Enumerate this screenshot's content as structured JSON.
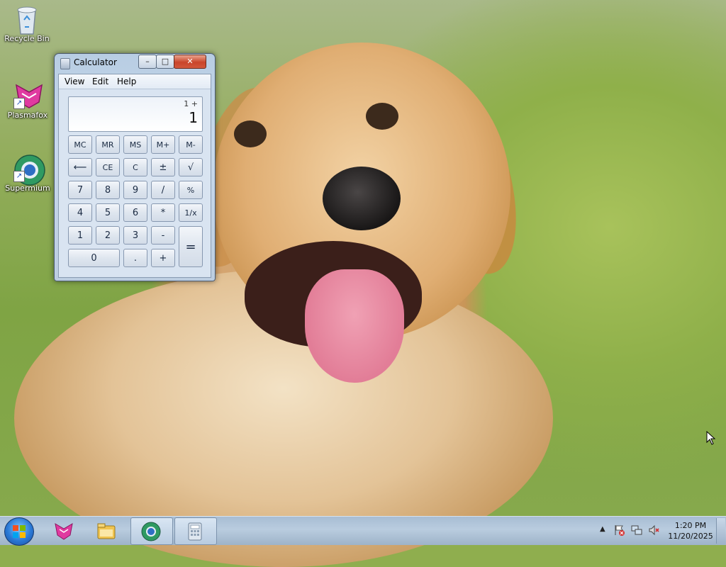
{
  "desktop": {
    "icons": [
      {
        "label": "Recycle Bin",
        "icon": "recycle-bin-icon"
      },
      {
        "label": "Plasmafox",
        "icon": "plasmafox-icon"
      },
      {
        "label": "Supermium",
        "icon": "supermium-icon"
      }
    ],
    "wallpaper": "golden retriever photo"
  },
  "calculator": {
    "title": "Calculator",
    "menu": [
      "View",
      "Edit",
      "Help"
    ],
    "display": {
      "history": "1 +",
      "value": "1"
    },
    "keys": {
      "row1": [
        "MC",
        "MR",
        "MS",
        "M+",
        "M-"
      ],
      "row2": [
        "⟵",
        "CE",
        "C",
        "±",
        "√"
      ],
      "row3": [
        "7",
        "8",
        "9",
        "/",
        "%"
      ],
      "row4": [
        "4",
        "5",
        "6",
        "*",
        "1/x"
      ],
      "row5": [
        "1",
        "2",
        "3",
        "-"
      ],
      "equals": "=",
      "row6": [
        "0",
        ".",
        "+"
      ]
    },
    "caption_buttons": {
      "minimize": "–",
      "maximize": "□",
      "close": "✕"
    }
  },
  "taskbar": {
    "pinned": [
      "plasmafox-icon",
      "file-explorer-icon",
      "supermium-icon",
      "calculator-icon"
    ],
    "active": "calculator-icon",
    "tray": {
      "overflow": "▲"
    },
    "clock": {
      "time": "1:20 PM",
      "date": "11/20/2025"
    }
  },
  "colors": {
    "accent": "#2a79d6",
    "close": "#c9442a"
  }
}
